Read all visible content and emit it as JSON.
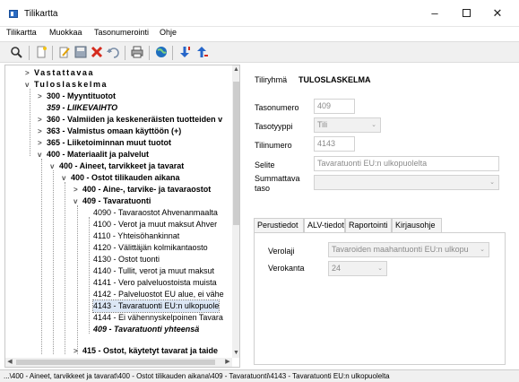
{
  "window": {
    "title": "Tilikartta",
    "minimize": "–",
    "close": "✕"
  },
  "menu": [
    "Tilikartta",
    "Muokkaa",
    "Tasonumerointi",
    "Ohje"
  ],
  "toolbar": {
    "icons": [
      "search-icon",
      "new-document-icon",
      "edit-icon",
      "save-icon",
      "delete-icon",
      "undo-icon",
      "print-icon",
      "globe-icon",
      "move-down-icon",
      "move-up-icon"
    ]
  },
  "tree": {
    "rows": [
      {
        "text": "Vastattavaa",
        "expander": ">"
      },
      {
        "text": "Tuloslaskelma",
        "expander": "v"
      },
      {
        "text": "300 - Myyntituotot",
        "expander": ">"
      },
      {
        "text": "359 - LIIKEVAIHTO",
        "expander": ""
      },
      {
        "text": "360 - Valmiiden ja keskeneräisten tuotteiden v",
        "expander": ">"
      },
      {
        "text": "363 - Valmistus omaan käyttöön (+)",
        "expander": ">"
      },
      {
        "text": "365 - Liiketoiminnan muut tuotot",
        "expander": ">"
      },
      {
        "text": "400 - Materiaalit ja palvelut",
        "expander": "v"
      },
      {
        "text": "400 - Aineet, tarvikkeet ja tavarat",
        "expander": "v"
      },
      {
        "text": "400 - Ostot tilikauden aikana",
        "expander": "v"
      },
      {
        "text": "400 - Aine-, tarvike- ja tavaraostot",
        "expander": ">"
      },
      {
        "text": "409 - Tavaratuonti",
        "expander": "v"
      },
      {
        "text": "4090 - Tavaraostot Ahvenanmaalta",
        "expander": ""
      },
      {
        "text": "4100 - Verot ja muut maksut Ahver",
        "expander": ""
      },
      {
        "text": "4110 - Yhteisöhankinnat",
        "expander": ""
      },
      {
        "text": "4120 - Välittäjän kolmikantaosto",
        "expander": ""
      },
      {
        "text": "4130 - Ostot tuonti",
        "expander": ""
      },
      {
        "text": "4140 - Tullit, verot ja muut maksut",
        "expander": ""
      },
      {
        "text": "4141 - Vero palveluostoista muista",
        "expander": ""
      },
      {
        "text": "4142 - Palveluostot EU alue, ei vähe",
        "expander": ""
      },
      {
        "text": "4143 - Tavaratuonti EU:n ulkopuole",
        "expander": ""
      },
      {
        "text": "4144 - Ei vähennyskelpoinen Tavara",
        "expander": ""
      },
      {
        "text": "409 - Tavaratuonti yhteensä",
        "expander": ""
      },
      {
        "text": "415 - Ostot, käytetyt tavarat ja taide",
        "expander": ">"
      }
    ],
    "selected_index": 20
  },
  "details": {
    "group_label": "Tiliryhmä",
    "group_value": "TULOSLASKELMA",
    "tasonumero_label": "Tasonumero",
    "tasonumero_value": "409",
    "tasotyyppi_label": "Tasotyyppi",
    "tasotyyppi_value": "Tili",
    "tilinumero_label": "Tilinumero",
    "tilinumero_value": "4143",
    "selite_label": "Selite",
    "selite_value": "Tavaratuonti EU:n ulkopuolelta",
    "summattava_label_1": "Summattava",
    "summattava_label_2": "taso",
    "summattava_value": ""
  },
  "tabs": [
    "Perustiedot",
    "ALV-tiedot",
    "Raportointi",
    "Kirjausohje"
  ],
  "active_tab": 1,
  "alv": {
    "veroalji_label": "Verolaji",
    "verolaji_value": "Tavaroiden maahantuonti EU:n ulkopu",
    "verokanta_label": "Verokanta",
    "verokanta_value": "24"
  },
  "status": {
    "path": "...\\400 - Aineet, tarvikkeet ja tavarat\\400 - Ostot tilikauden aikana\\409 - Tavaratuonti\\4143 - Tavaratuonti EU:n ulkopuolelta"
  }
}
